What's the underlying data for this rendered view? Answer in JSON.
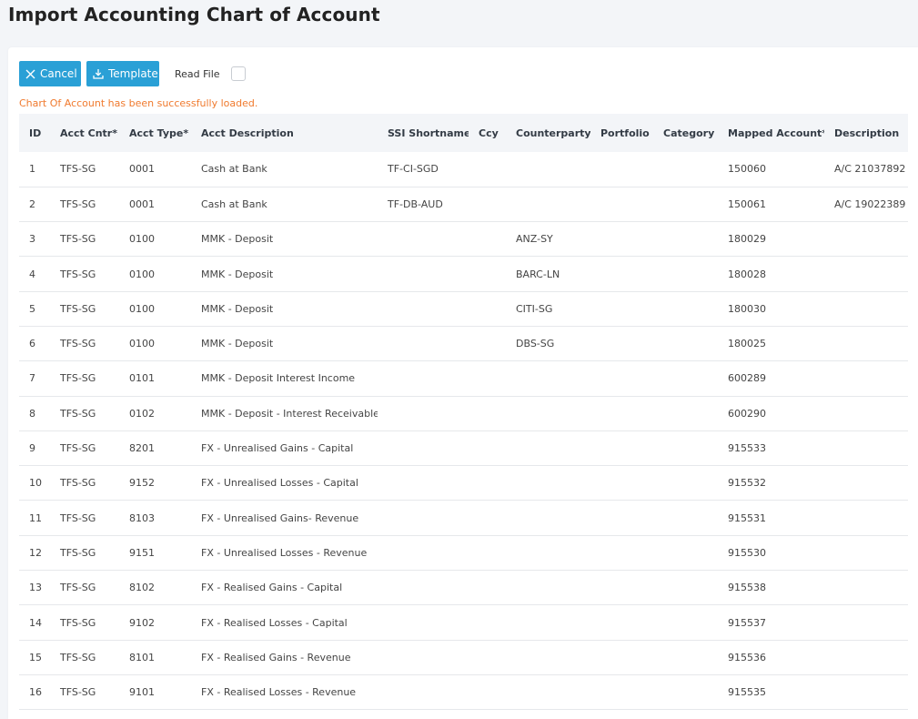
{
  "page": {
    "title": "Import Accounting Chart of Account"
  },
  "toolbar": {
    "cancel_label": "Cancel",
    "template_label": "Template",
    "read_file_label": "Read File",
    "read_file_checked": false
  },
  "status": {
    "message": "Chart Of Account has been successfully loaded."
  },
  "colors": {
    "button": "#2aa0d6",
    "status_text": "#f07a2e",
    "header_bg": "#f3f5f8"
  },
  "table": {
    "columns": [
      "ID",
      "Acct Cntr*",
      "Acct Type*",
      "Acct Description",
      "SSI Shortname",
      "Ccy",
      "Counterparty",
      "Portfolio",
      "Category",
      "Mapped Account*",
      "Description"
    ],
    "rows": [
      [
        "1",
        "TFS-SG",
        "0001",
        "Cash at Bank",
        "TF-CI-SGD",
        "",
        "",
        "",
        "",
        "150060",
        "A/C 21037892"
      ],
      [
        "2",
        "TFS-SG",
        "0001",
        "Cash at Bank",
        "TF-DB-AUD",
        "",
        "",
        "",
        "",
        "150061",
        "A/C 19022389"
      ],
      [
        "3",
        "TFS-SG",
        "0100",
        "MMK - Deposit",
        "",
        "",
        "ANZ-SY",
        "",
        "",
        "180029",
        ""
      ],
      [
        "4",
        "TFS-SG",
        "0100",
        "MMK - Deposit",
        "",
        "",
        "BARC-LN",
        "",
        "",
        "180028",
        ""
      ],
      [
        "5",
        "TFS-SG",
        "0100",
        "MMK - Deposit",
        "",
        "",
        "CITI-SG",
        "",
        "",
        "180030",
        ""
      ],
      [
        "6",
        "TFS-SG",
        "0100",
        "MMK - Deposit",
        "",
        "",
        "DBS-SG",
        "",
        "",
        "180025",
        ""
      ],
      [
        "7",
        "TFS-SG",
        "0101",
        "MMK - Deposit Interest Income",
        "",
        "",
        "",
        "",
        "",
        "600289",
        ""
      ],
      [
        "8",
        "TFS-SG",
        "0102",
        "MMK - Deposit - Interest Receivables",
        "",
        "",
        "",
        "",
        "",
        "600290",
        ""
      ],
      [
        "9",
        "TFS-SG",
        "8201",
        "FX - Unrealised Gains - Capital",
        "",
        "",
        "",
        "",
        "",
        "915533",
        ""
      ],
      [
        "10",
        "TFS-SG",
        "9152",
        "FX - Unrealised Losses - Capital",
        "",
        "",
        "",
        "",
        "",
        "915532",
        ""
      ],
      [
        "11",
        "TFS-SG",
        "8103",
        "FX - Unrealised Gains- Revenue",
        "",
        "",
        "",
        "",
        "",
        "915531",
        ""
      ],
      [
        "12",
        "TFS-SG",
        "9151",
        "FX - Unrealised Losses - Revenue",
        "",
        "",
        "",
        "",
        "",
        "915530",
        ""
      ],
      [
        "13",
        "TFS-SG",
        "8102",
        "FX - Realised Gains - Capital",
        "",
        "",
        "",
        "",
        "",
        "915538",
        ""
      ],
      [
        "14",
        "TFS-SG",
        "9102",
        "FX - Realised Losses - Capital",
        "",
        "",
        "",
        "",
        "",
        "915537",
        ""
      ],
      [
        "15",
        "TFS-SG",
        "8101",
        "FX - Realised Gains - Revenue",
        "",
        "",
        "",
        "",
        "",
        "915536",
        ""
      ],
      [
        "16",
        "TFS-SG",
        "9101",
        "FX - Realised Losses - Revenue",
        "",
        "",
        "",
        "",
        "",
        "915535",
        ""
      ]
    ]
  }
}
